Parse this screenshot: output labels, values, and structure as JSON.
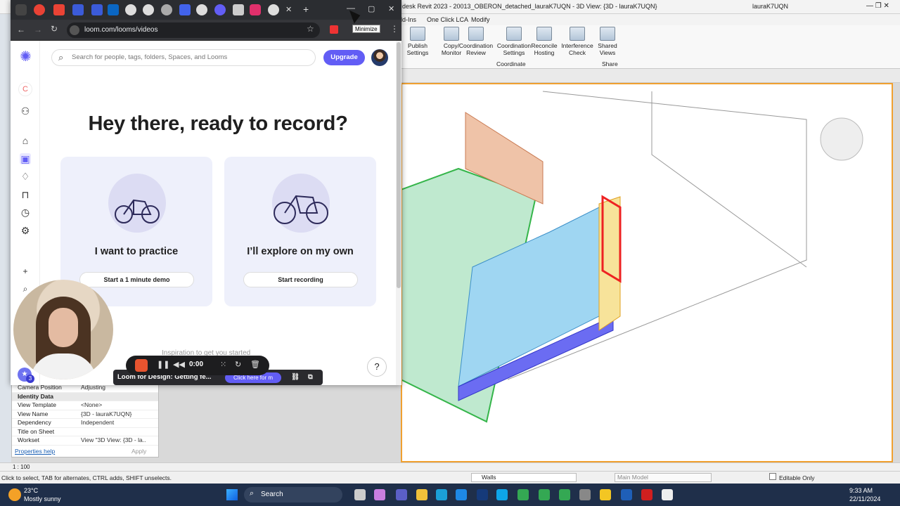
{
  "revit": {
    "title": "desk Revit 2023 - 20013_OBERON_detached_lauraK7UQN - 3D View: {3D - lauraK7UQN}",
    "user": "lauraK7UQN",
    "ribbon_tabs": [
      "ld-Ins",
      "One Click LCA",
      "Modify"
    ],
    "ribbon_buttons": [
      "Publish Settings",
      "Copy/ Monitor",
      "Coordination Review",
      "Coordination Settings",
      "Reconcile Hosting",
      "Interference Check",
      "Shared Views"
    ],
    "groups": {
      "coordinate": "Coordinate",
      "share": "Share"
    },
    "properties": [
      {
        "label": "Camera Position",
        "value": "Adjusting"
      },
      {
        "label": "Identity Data",
        "value": ""
      },
      {
        "label": "View Template",
        "value": "<None>"
      },
      {
        "label": "View Name",
        "value": "{3D - lauraK7UQN}"
      },
      {
        "label": "Dependency",
        "value": "Independent"
      },
      {
        "label": "Title on Sheet",
        "value": ""
      },
      {
        "label": "Workset",
        "value": "View \"3D View: {3D - la..."
      }
    ],
    "properties_help": "Properties help",
    "apply": "Apply",
    "scale": "1 : 100",
    "status_text": "Click to select, TAB for alternates, CTRL adds, SHIFT unselects.",
    "walls_filter": "Walls",
    "main_model": "Main Model",
    "editable_only": "Editable Only"
  },
  "taskbar": {
    "weather_temp": "23°C",
    "weather_desc": "Mostly sunny",
    "search": "Search",
    "time": "9:33 AM",
    "date": "22/11/2024"
  },
  "chrome": {
    "url": "loom.com/looms/videos",
    "tooltip": "Minimize"
  },
  "loom": {
    "search_placeholder": "Search for people, tags, folders, Spaces, and Looms",
    "upgrade": "Upgrade",
    "heading": "Hey there, ready to record?",
    "cards": [
      {
        "title": "I want to practice",
        "button": "Start a 1 minute demo"
      },
      {
        "title": "I’ll explore on my own",
        "button": "Start recording"
      }
    ],
    "inspiration": "Inspiration to get you started",
    "help": "?",
    "avatar_initial": "C",
    "webcam_badge": "3"
  },
  "recorder": {
    "time": "0:00",
    "notice": "Loom for Design: Getting fe...",
    "notice_button": "Click here for m"
  }
}
